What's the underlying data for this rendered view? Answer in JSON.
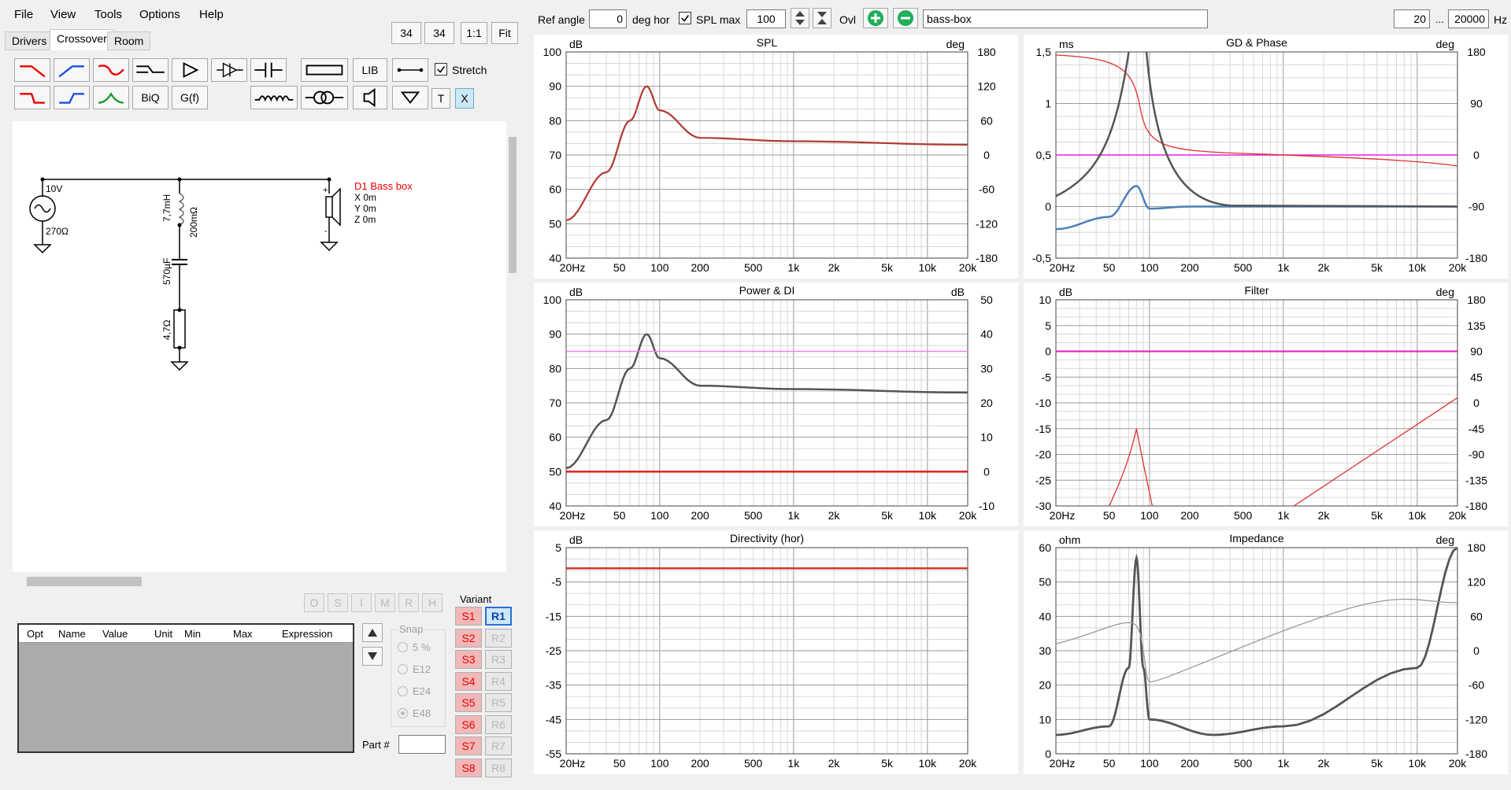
{
  "menu": [
    "File",
    "View",
    "Tools",
    "Options",
    "Help"
  ],
  "tabs": [
    "Drivers",
    "Crossover",
    "Room"
  ],
  "zoom_buttons": [
    "34",
    "34",
    "1:1",
    "Fit"
  ],
  "toolbar": {
    "lib": "LIB",
    "stretch": "Stretch",
    "biq": "BiQ",
    "gf": "G(f)",
    "t": "T",
    "x": "X"
  },
  "schematic": {
    "source_voltage": "10V",
    "source_impedance": "270Ω",
    "inductor": "7,7mH",
    "inductor_res": "200mΩ",
    "capacitor": "570µF",
    "resistor": "4,7Ω",
    "driver_name": "D1 Bass box",
    "driver_x": "X 0m",
    "driver_y": "Y 0m",
    "driver_z": "Z 0m"
  },
  "parts_buttons": [
    "O",
    "S",
    "I",
    "M",
    "R",
    "H"
  ],
  "table_headers": [
    "Opt",
    "Name",
    "Value",
    "Unit",
    "Min",
    "Max",
    "Expression"
  ],
  "snap": {
    "label": "Snap",
    "options": [
      "5 %",
      "E12",
      "E24",
      "E48"
    ]
  },
  "part_label": "Part #",
  "variant": {
    "label": "Variant",
    "s": [
      "S1",
      "S2",
      "S3",
      "S4",
      "S5",
      "S6",
      "S7",
      "S8"
    ],
    "r": [
      "R1",
      "R2",
      "R3",
      "R4",
      "R5",
      "R6",
      "R7",
      "R8"
    ]
  },
  "topbar": {
    "ref_angle_label": "Ref angle",
    "ref_angle": "0",
    "deg_hor": "deg hor",
    "spl_max_label": "SPL max",
    "spl_max": "100",
    "ovl": "Ovl",
    "name": "bass-box",
    "f_min": "20",
    "dots": "...",
    "f_max": "20000",
    "hz": "Hz"
  },
  "x_ticks": [
    "20Hz",
    "50",
    "100",
    "200",
    "500",
    "1k",
    "2k",
    "5k",
    "10k",
    "20k"
  ],
  "charts": [
    {
      "title": "SPL",
      "lunit": "dB",
      "runit": "deg",
      "lticks": [
        "100",
        "90",
        "80",
        "70",
        "60",
        "50",
        "40"
      ],
      "rticks": [
        "180",
        "120",
        "60",
        "0",
        "-60",
        "-120",
        "-180"
      ]
    },
    {
      "title": "GD & Phase",
      "lunit": "ms",
      "runit": "deg",
      "lticks": [
        "1,5",
        "1",
        "0,5",
        "0",
        "-0,5"
      ],
      "rticks": [
        "180",
        "90",
        "0",
        "-90",
        "-180"
      ]
    },
    {
      "title": "Power & DI",
      "lunit": "dB",
      "runit": "dB",
      "lticks": [
        "100",
        "90",
        "80",
        "70",
        "60",
        "50",
        "40"
      ],
      "rticks": [
        "50",
        "40",
        "30",
        "20",
        "10",
        "0",
        "-10"
      ]
    },
    {
      "title": "Filter",
      "lunit": "dB",
      "runit": "deg",
      "lticks": [
        "10",
        "5",
        "0",
        "-5",
        "-10",
        "-15",
        "-20",
        "-25",
        "-30"
      ],
      "rticks": [
        "180",
        "135",
        "90",
        "45",
        "0",
        "-45",
        "-90",
        "-135",
        "-180"
      ]
    },
    {
      "title": "Directivity (hor)",
      "lunit": "dB",
      "runit": "",
      "lticks": [
        "5",
        "-5",
        "-15",
        "-25",
        "-35",
        "-45",
        "-55"
      ],
      "rticks": []
    },
    {
      "title": "Impedance",
      "lunit": "ohm",
      "runit": "deg",
      "lticks": [
        "60",
        "50",
        "40",
        "30",
        "20",
        "10",
        "0"
      ],
      "rticks": [
        "180",
        "120",
        "60",
        "0",
        "-60",
        "-120",
        "-180"
      ]
    }
  ],
  "chart_data": [
    {
      "type": "line",
      "title": "SPL",
      "ylabel": "dB",
      "ylim": [
        40,
        100
      ],
      "x": [
        20,
        40,
        60,
        80,
        100,
        200,
        1000,
        20000
      ],
      "series": [
        {
          "values": [
            51,
            65,
            80,
            90,
            83,
            75,
            74,
            73
          ]
        }
      ]
    },
    {
      "type": "line",
      "title": "GD & Phase",
      "ylabel": "ms",
      "ylim": [
        -0.5,
        1.5
      ],
      "x": [
        20,
        50,
        80,
        100,
        200,
        1000,
        20000
      ],
      "series": [
        {
          "values": [
            -0.22,
            -0.1,
            0.2,
            -0.02,
            0,
            0,
            0
          ]
        }
      ]
    },
    {
      "type": "line",
      "title": "Power & DI",
      "ylabel": "dB",
      "ylim": [
        40,
        100
      ],
      "x": [
        20,
        40,
        60,
        80,
        100,
        200,
        1000,
        20000
      ],
      "series": [
        {
          "values": [
            51,
            65,
            80,
            90,
            83,
            75,
            74,
            73
          ]
        }
      ]
    },
    {
      "type": "line",
      "title": "Filter",
      "ylabel": "dB",
      "ylim": [
        -30,
        10
      ],
      "x": [
        20,
        50,
        80,
        100,
        200,
        1000,
        20000
      ],
      "series": [
        {
          "values": [
            0,
            0,
            0,
            0,
            0,
            0,
            0
          ]
        }
      ]
    },
    {
      "type": "line",
      "title": "Directivity (hor)",
      "ylabel": "dB",
      "ylim": [
        -55,
        5
      ],
      "x": [
        20,
        20000
      ],
      "series": [
        {
          "values": [
            -1,
            -1
          ]
        }
      ]
    },
    {
      "type": "line",
      "title": "Impedance",
      "ylabel": "ohm",
      "ylim": [
        0,
        60
      ],
      "x": [
        20,
        50,
        70,
        80,
        90,
        100,
        300,
        1000,
        10000,
        20000
      ],
      "series": [
        {
          "values": [
            5.5,
            8,
            25,
            57,
            25,
            10,
            5.5,
            8,
            25,
            60
          ]
        }
      ]
    }
  ]
}
